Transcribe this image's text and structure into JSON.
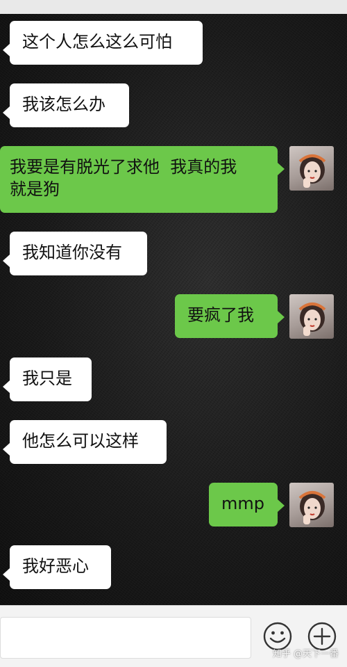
{
  "messages": [
    {
      "side": "in",
      "text": "这个人怎么这么可怕"
    },
    {
      "side": "in",
      "text": "我该怎么办"
    },
    {
      "side": "out",
      "text": "我要是有脱光了求他  我真的我\n就是狗"
    },
    {
      "side": "in",
      "text": "我知道你没有"
    },
    {
      "side": "out",
      "text": "要疯了我"
    },
    {
      "side": "in",
      "text": "我只是"
    },
    {
      "side": "in",
      "text": "他怎么可以这样"
    },
    {
      "side": "out",
      "text": "mmp"
    },
    {
      "side": "in",
      "text": "我好恶心"
    }
  ],
  "input_bar": {
    "emoji_icon": "smiley-icon",
    "add_icon": "plus-icon",
    "watermark": "知乎 @天下一番"
  },
  "colors": {
    "incoming": "#ffffff",
    "outgoing": "#6cc84a"
  }
}
